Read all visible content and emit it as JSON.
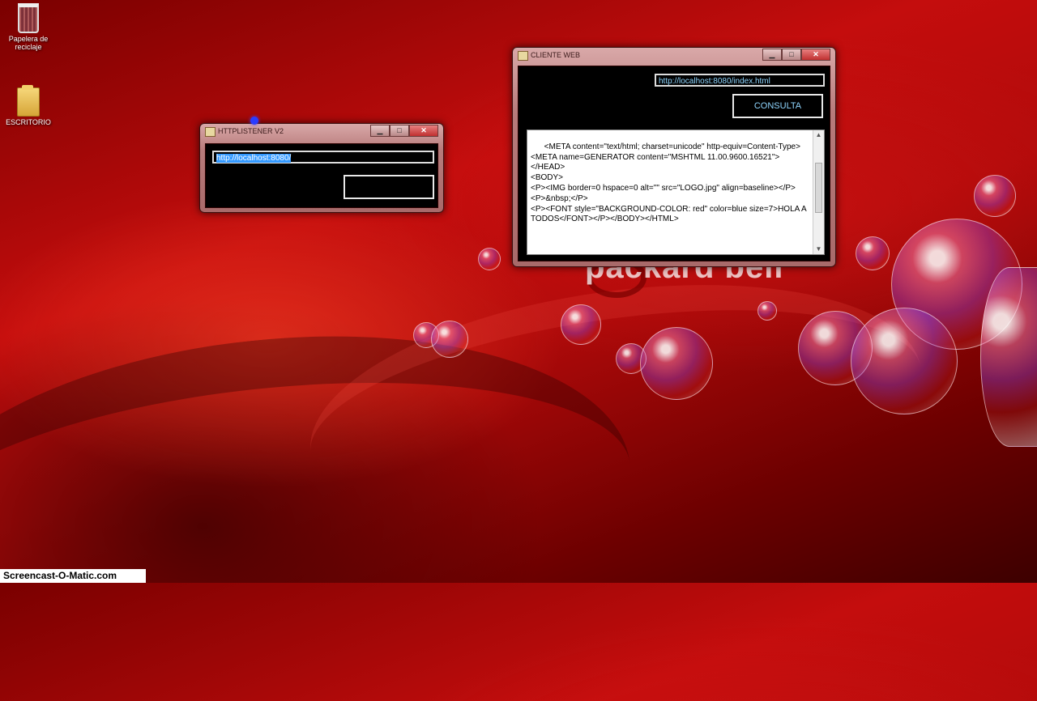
{
  "desktop": {
    "icons": [
      {
        "label": "Papelera de reciclaje"
      },
      {
        "label": "ESCRITORIO"
      }
    ],
    "wallpaper_brand": "packard bell"
  },
  "listener_window": {
    "title": "HTTPLISTENER V2",
    "url_value": "http://localhost:8080/",
    "button_label": ""
  },
  "client_window": {
    "title": "CLIENTE WEB",
    "url_value": "http://localhost:8080/index.html",
    "button_label": "CONSULTA",
    "response_text": "<META content=\"text/html; charset=unicode\" http-equiv=Content-Type>\n<META name=GENERATOR content=\"MSHTML 11.00.9600.16521\"></HEAD>\n<BODY>\n<P><IMG border=0 hspace=0 alt=\"\" src=\"LOGO.jpg\" align=baseline></P>\n<P>&nbsp;</P>\n<P><FONT style=\"BACKGROUND-COLOR: red\" color=blue size=7>HOLA A TODOS</FONT></P></BODY></HTML>"
  },
  "window_controls": {
    "minimize": "▁",
    "maximize": "□",
    "close": "✕"
  },
  "watermark": "Screencast-O-Matic.com",
  "colors": {
    "background": "#b00a0a",
    "button_text": "#8fd6ff",
    "selection": "#3399ff"
  }
}
